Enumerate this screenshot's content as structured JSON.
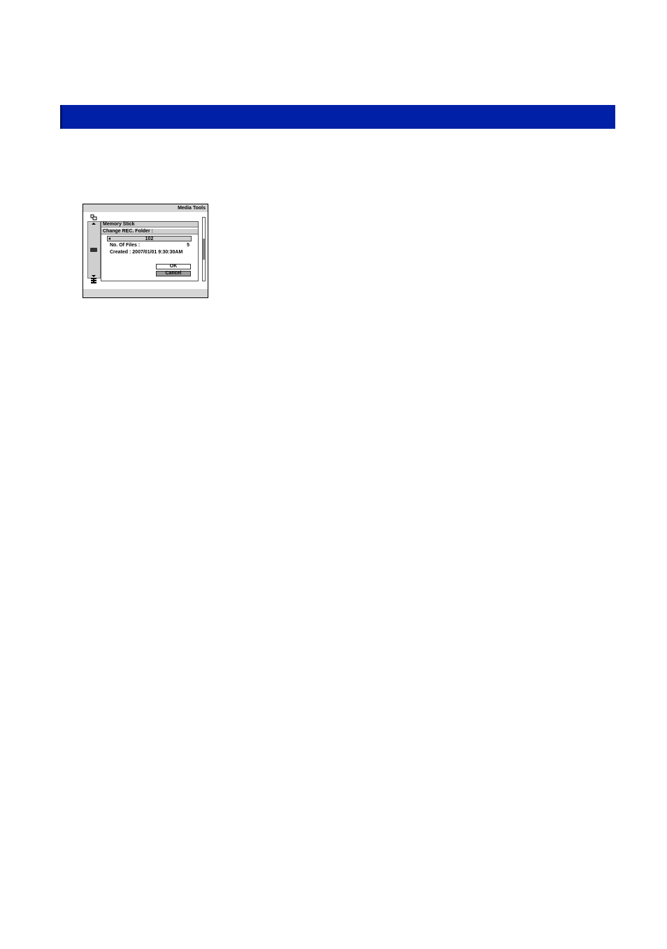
{
  "colors": {
    "header_bar": "#0020a8",
    "header_bar_edge": "#001266",
    "screen_chrome": "#d6d6d6",
    "cancel_button": "#9a9a9a"
  },
  "screen": {
    "title": "Media Tools",
    "icons": {
      "top_left": "media-tools-icon",
      "memory": "memory-stick-icon",
      "bottom_left": "settings-icon"
    }
  },
  "dialog": {
    "media_label": "Memory Stick",
    "heading": "Change REC. Folder :",
    "folder_value": "102",
    "files_label": "No. Of  Files :",
    "files_value": "5",
    "created_text": "Created :  2007/01/01    9:30:30AM",
    "ok_label": "OK",
    "cancel_label": "Cancel"
  }
}
